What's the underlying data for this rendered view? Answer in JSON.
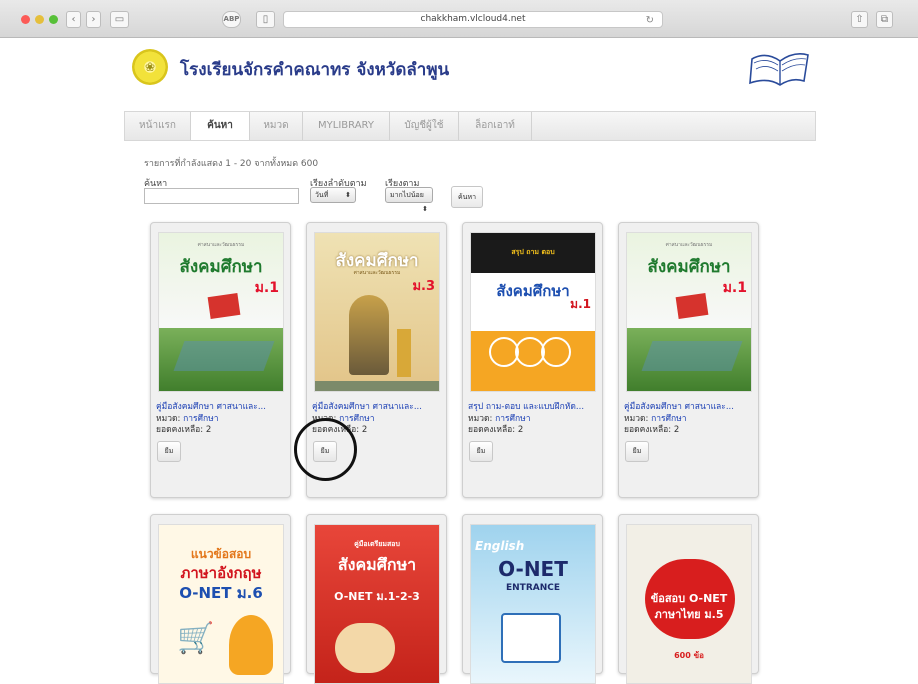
{
  "browser": {
    "url": "chakkham.vlcloud4.net",
    "ext_label": "ABP"
  },
  "site": {
    "title": "โรงเรียนจักรคำคณาทร จังหวัดลำพูน"
  },
  "menu": {
    "items": [
      {
        "label": "หน้าแรก"
      },
      {
        "label": "ค้นหา"
      },
      {
        "label": "หมวด"
      },
      {
        "label": "MYLIBRARY"
      },
      {
        "label": "บัญชีผู้ใช้"
      },
      {
        "label": "ล็อกเอาท์"
      }
    ]
  },
  "search": {
    "result_text": "รายการที่กำลังแสดง 1 - 20 จากทั้งหมด 600",
    "search_label": "ค้นหา",
    "search_value": "",
    "sort_label": "เรียงลำดับตาม",
    "sort_value": "วันที่",
    "order_label": "เรียงตาม",
    "order_value": "มากไปน้อย",
    "button_label": "ค้นหา"
  },
  "cards": [
    {
      "title": "คู่มือสังคมศึกษา ศาสนาและ...",
      "category_label": "หมวด:",
      "category": "การศึกษา",
      "remaining": "ยอดคงเหลือ: 2",
      "borrow_label": "ยืม",
      "cover": {
        "headline": "สังคมศึกษา",
        "grade": "ม.1",
        "sub": "ศาสนาและวัฒนธรรม",
        "theme": "rice"
      }
    },
    {
      "title": "คู่มือสังคมศึกษา ศาสนาและ...",
      "category_label": "หมวด:",
      "category": "การศึกษา",
      "remaining": "ยอดคงเหลือ: 2",
      "borrow_label": "ยืม",
      "cover": {
        "headline": "สังคมศึกษา",
        "grade": "ม.3",
        "sub": "ศาสนาและวัฒนธรรม",
        "theme": "temple"
      }
    },
    {
      "title": "สรุป ถาม-ตอบ และแบบฝึกหัด...",
      "category_label": "หมวด:",
      "category": "การศึกษา",
      "remaining": "ยอดคงเหลือ: 2",
      "borrow_label": "ยืม",
      "cover": {
        "headline": "สังคมศึกษา",
        "grade": "ม.1",
        "sub": "สรุป ถาม ตอบ",
        "theme": "orange"
      }
    },
    {
      "title": "คู่มือสังคมศึกษา ศาสนาและ...",
      "category_label": "หมวด:",
      "category": "การศึกษา",
      "remaining": "ยอดคงเหลือ: 2",
      "borrow_label": "ยืม",
      "cover": {
        "headline": "สังคมศึกษา",
        "grade": "ม.1",
        "sub": "ศาสนาและวัฒนธรรม",
        "theme": "rice"
      }
    },
    {
      "cover": {
        "headline": "ภาษาอังกฤษ",
        "grade": "O-NET ม.6",
        "sub": "แนวข้อสอบ",
        "theme": "english"
      }
    },
    {
      "cover": {
        "headline": "สังคมศึกษา",
        "grade": "O-NET ม.1-2-3",
        "sub": "คู่มือเตรียมสอบ",
        "theme": "red"
      }
    },
    {
      "cover": {
        "headline": "O-NET",
        "grade": "ENTRANCE",
        "sub": "English",
        "theme": "blue"
      }
    },
    {
      "cover": {
        "headline": "ข้อสอบ O-NET",
        "grade": "ภาษาไทย ม.5",
        "sub": "600 ข้อ",
        "theme": "thai"
      }
    }
  ]
}
